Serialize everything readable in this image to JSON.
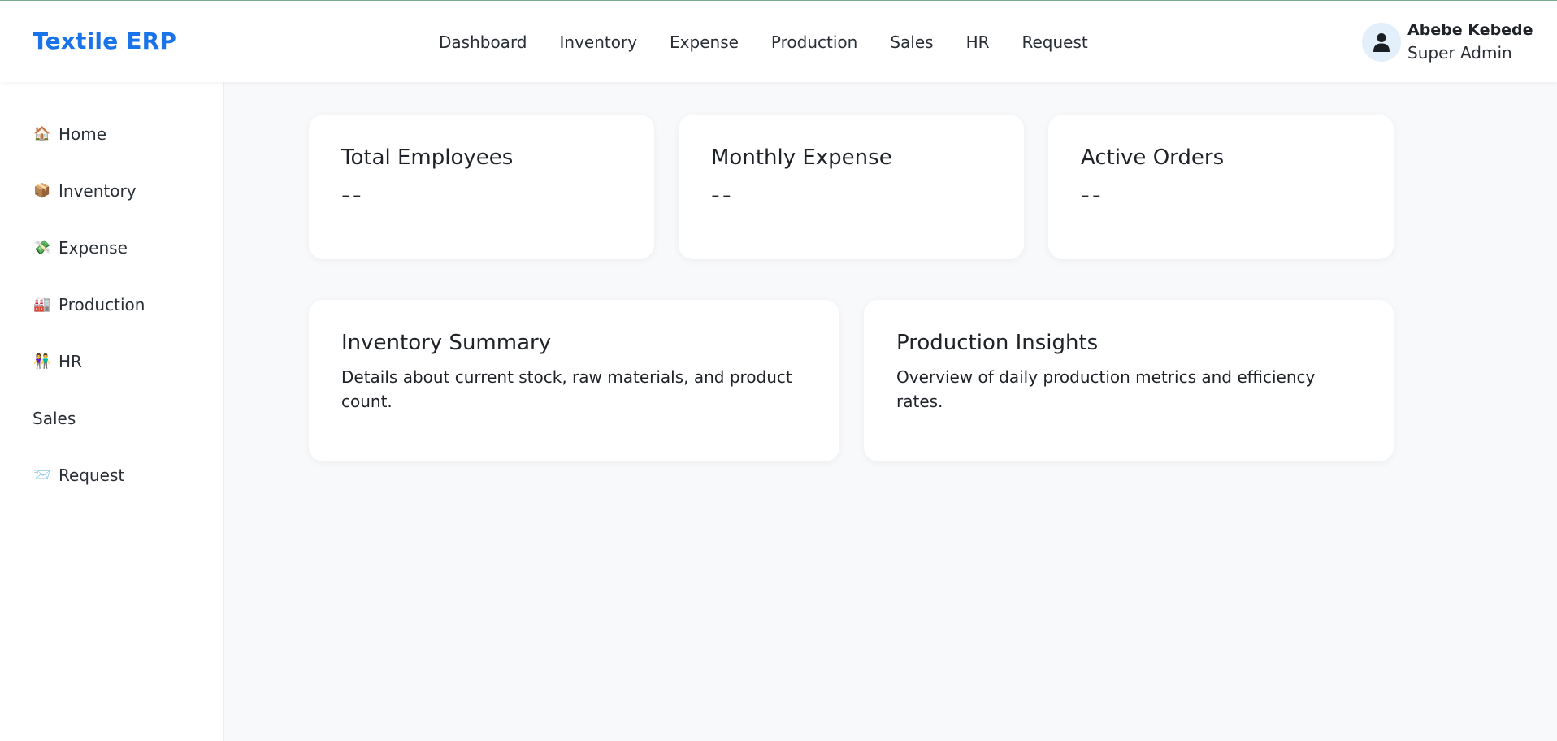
{
  "brand": "Textile ERP",
  "top_nav": [
    {
      "label": "Dashboard"
    },
    {
      "label": "Inventory"
    },
    {
      "label": "Expense"
    },
    {
      "label": "Production"
    },
    {
      "label": "Sales"
    },
    {
      "label": "HR"
    },
    {
      "label": "Request"
    }
  ],
  "user": {
    "name": "Abebe Kebede",
    "role": "Super Admin",
    "avatar_icon": "user-icon"
  },
  "sidebar": {
    "items": [
      {
        "label": "Home",
        "icon": "🏠",
        "icon_name": "house-icon"
      },
      {
        "label": "Inventory",
        "icon": "📦",
        "icon_name": "package-icon"
      },
      {
        "label": "Expense",
        "icon": "💸",
        "icon_name": "money-icon"
      },
      {
        "label": "Production",
        "icon": "🏭",
        "icon_name": "factory-icon"
      },
      {
        "label": "HR",
        "icon": "👫",
        "icon_name": "people-icon"
      },
      {
        "label": "Sales",
        "icon": "",
        "icon_name": ""
      },
      {
        "label": "Request",
        "icon": "📨",
        "icon_name": "envelope-icon"
      }
    ]
  },
  "stats": [
    {
      "title": "Total Employees",
      "value": "--"
    },
    {
      "title": "Monthly Expense",
      "value": "--"
    },
    {
      "title": "Active Orders",
      "value": "--"
    }
  ],
  "panels": [
    {
      "title": "Inventory Summary",
      "description": "Details about current stock, raw materials, and product count."
    },
    {
      "title": "Production Insights",
      "description": "Overview of daily production metrics and efficiency rates."
    }
  ],
  "colors": {
    "brand": "#1a73e8",
    "background": "#f8f9fb",
    "avatar_bg": "#e3effb"
  }
}
